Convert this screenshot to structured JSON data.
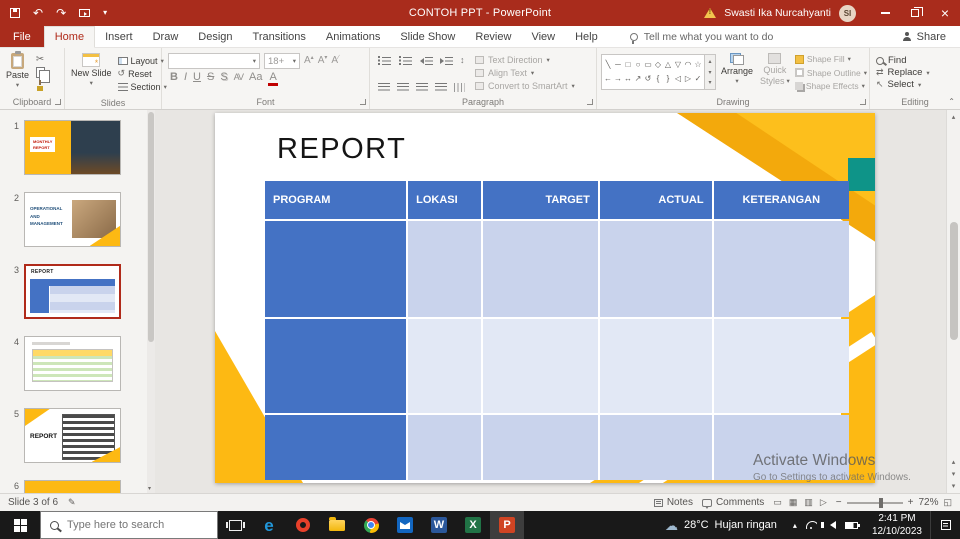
{
  "colors": {
    "titlebar_red": "#a92c1c",
    "table_header_blue": "#4472c4",
    "row_light_blue": "#c9d3ec",
    "row_lighter_blue": "#e2e8f5",
    "accent_yellow": "#fdb913",
    "accent_teal": "#0e9488"
  },
  "titlebar": {
    "title": "CONTOH PPT - PowerPoint",
    "user_name": "Swasti Ika Nurcahyanti",
    "avatar_initials": "SI"
  },
  "tabs": [
    {
      "label": "File"
    },
    {
      "label": "Home"
    },
    {
      "label": "Insert"
    },
    {
      "label": "Draw"
    },
    {
      "label": "Design"
    },
    {
      "label": "Transitions"
    },
    {
      "label": "Animations"
    },
    {
      "label": "Slide Show"
    },
    {
      "label": "Review"
    },
    {
      "label": "View"
    },
    {
      "label": "Help"
    }
  ],
  "tellme_label": "Tell me what you want to do",
  "share_label": "Share",
  "ribbon": {
    "clipboard": {
      "title": "Clipboard",
      "paste_label": "Paste"
    },
    "slides": {
      "title": "Slides",
      "new_slide_label": "New Slide",
      "layout_label": "Layout",
      "reset_label": "Reset",
      "section_label": "Section"
    },
    "font": {
      "title": "Font",
      "font_name": "",
      "font_size": "18+",
      "bold_label": "B",
      "italic_label": "I",
      "underline_label": "U",
      "strike_label": "S",
      "shadow_label": "S",
      "spacing_label": "AV",
      "case_label": "Aa",
      "color_label": "A",
      "increase_label": "A",
      "decrease_label": "A",
      "clear_label": "A"
    },
    "paragraph": {
      "title": "Paragraph",
      "text_direction_label": "Text Direction",
      "align_text_label": "Align Text",
      "smartart_label": "Convert to SmartArt"
    },
    "drawing": {
      "title": "Drawing",
      "arrange_label": "Arrange",
      "quick_styles_label1": "Quick",
      "quick_styles_label2": "Styles",
      "shape_fill_label": "Shape Fill",
      "shape_outline_label": "Shape Outline",
      "shape_effects_label": "Shape Effects"
    },
    "editing": {
      "title": "Editing",
      "find_label": "Find",
      "replace_label": "Replace",
      "select_label": "Select"
    }
  },
  "sidebar": {
    "thumbnails": [
      {
        "number": "1",
        "label1": "MONTHLY",
        "label2": "REPORT"
      },
      {
        "number": "2",
        "label1": "OPERATIONAL",
        "label2": "AND",
        "label3": "MANAGEMENT"
      },
      {
        "number": "3",
        "label1": "REPORT",
        "selected": true
      },
      {
        "number": "4"
      },
      {
        "number": "5",
        "label1": "REPORT"
      },
      {
        "number": "6"
      }
    ]
  },
  "slide": {
    "title": "REPORT",
    "table_headers": [
      "PROGRAM",
      "LOKASI",
      "TARGET",
      "ACTUAL",
      "KETERANGAN"
    ]
  },
  "watermark": {
    "line1": "Activate Windows",
    "line2": "Go to Settings to activate Windows."
  },
  "statusbar": {
    "slide_indicator": "Slide 3 of 6",
    "notes_label": "Notes",
    "comments_label": "Comments",
    "zoom_level": "72%"
  },
  "taskbar": {
    "search_placeholder": "Type here to search",
    "weather_temp": "28°C",
    "weather_desc": "Hujan ringan",
    "time": "2:41 PM",
    "date": "12/10/2023"
  }
}
